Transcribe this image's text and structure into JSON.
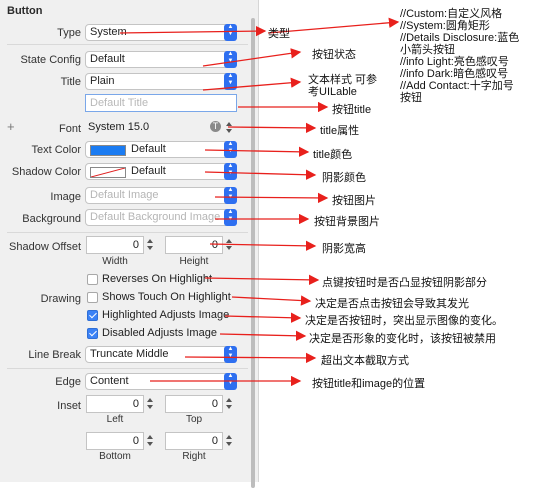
{
  "section": {
    "title": "Button"
  },
  "rows": {
    "type": {
      "label": "Type",
      "value": "System"
    },
    "state_config": {
      "label": "State Config",
      "value": "Default"
    },
    "title": {
      "label": "Title",
      "value": "Plain"
    },
    "title_field": {
      "placeholder": "Default Title"
    },
    "font": {
      "label": "Font",
      "value": "System 15.0"
    },
    "text_color": {
      "label": "Text Color",
      "value": "Default",
      "swatch": "#1b7cf2"
    },
    "shadow_color": {
      "label": "Shadow Color",
      "value": "Default"
    },
    "image": {
      "label": "Image",
      "placeholder": "Default Image"
    },
    "background": {
      "label": "Background",
      "placeholder": "Default Background Image"
    },
    "shadow_offset": {
      "label": "Shadow Offset",
      "width": "0",
      "height": "0",
      "width_label": "Width",
      "height_label": "Height"
    },
    "drawing": {
      "label": "Drawing",
      "reverses": "Reverses On Highlight",
      "shows_touch": "Shows Touch On Highlight",
      "highlighted_adjusts": "Highlighted Adjusts Image",
      "disabled_adjusts": "Disabled Adjusts Image"
    },
    "line_break": {
      "label": "Line Break",
      "value": "Truncate Middle"
    },
    "edge": {
      "label": "Edge",
      "value": "Content"
    },
    "inset": {
      "label": "Inset",
      "left": "0",
      "top": "0",
      "bottom": "0",
      "right": "0",
      "left_label": "Left",
      "top_label": "Top",
      "bottom_label": "Bottom",
      "right_label": "Right"
    }
  },
  "annotations": {
    "type": "类型",
    "type_desc": "//Custom:自定义风格\n//System:圆角矩形\n//Details Disclosure:蓝色\n小箭头按钮\n//info Light:亮色感叹号\n//info Dark:暗色感叹号\n//Add Contact:十字加号\n按钮",
    "state": "按钮状态",
    "title_style": "文本样式 可参\n考UILable",
    "button_title": "按钮title",
    "title_attr": "title属性",
    "title_color": "title颜色",
    "shadow_color": "阴影颜色",
    "image": "按钮图片",
    "background": "按钮背景图片",
    "shadow_size": "阴影宽高",
    "reverses": "点键按钮时是否凸显按钮阴影部分",
    "shows_touch": "决定是否点击按钮会导致其发光",
    "highlighted": "决定是否按钮时，突出显示图像的变化。",
    "disabled": "决定是否形象的变化时，该按钮被禁用",
    "line_break": "超出文本截取方式",
    "edge": "按钮title和image的位置"
  },
  "colors": {
    "arrow": "#e8201c",
    "accent": "#2e6ff0"
  }
}
